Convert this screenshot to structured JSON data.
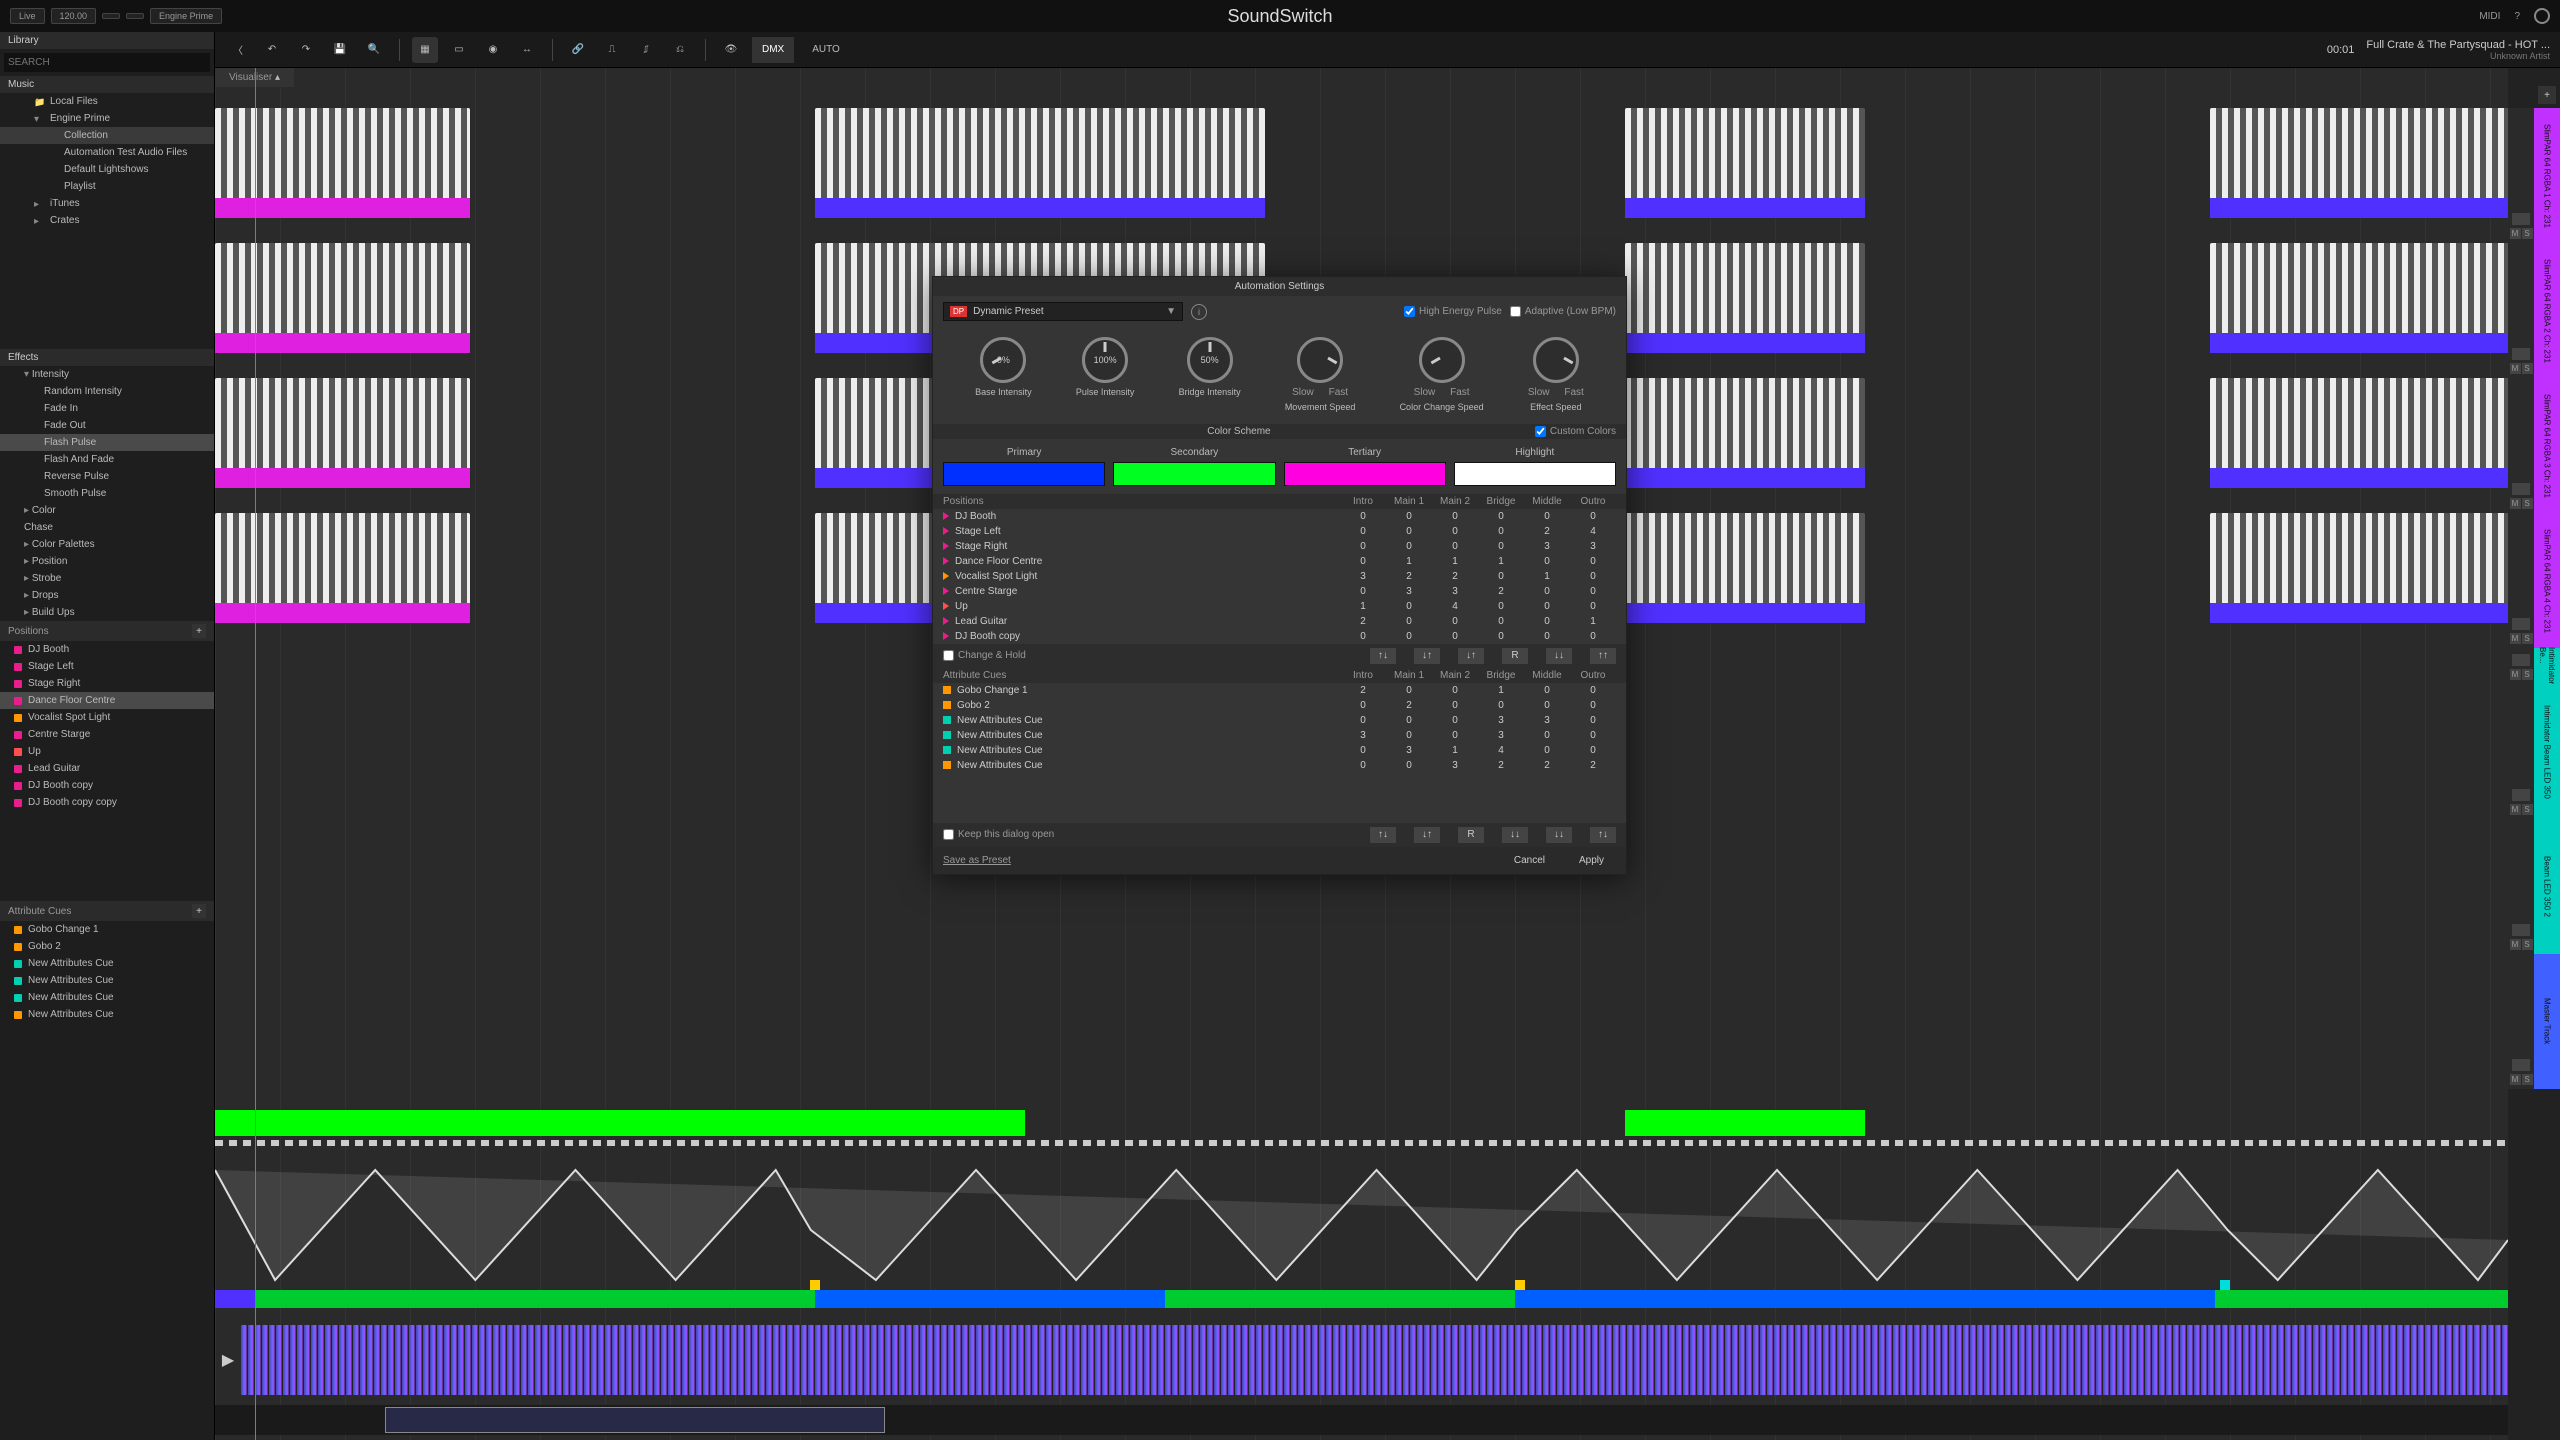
{
  "app": {
    "title": "SoundSwitch"
  },
  "topbar": {
    "live": "Live",
    "bpm": "120.00",
    "source": "Engine Prime",
    "midi": "MIDI",
    "help": "?"
  },
  "toolbar": {
    "dmx": "DMX",
    "auto": "AUTO",
    "time": "00:01",
    "track_title": "Full Crate & The Partysquad - HOT ...",
    "track_artist": "Unknown Artist",
    "visualiser": "Visualiser"
  },
  "library": {
    "header": "Library",
    "search_ph": "SEARCH",
    "music": "Music",
    "items": [
      {
        "label": "Local Files",
        "cls": "folder sub"
      },
      {
        "label": "Engine Prime",
        "cls": "expand2 sub"
      },
      {
        "label": "Collection",
        "cls": "sub2 sel"
      },
      {
        "label": "Automation Test Audio Files",
        "cls": "sub2"
      },
      {
        "label": "Default Lightshows",
        "cls": "sub2"
      },
      {
        "label": "Playlist",
        "cls": "sub2"
      },
      {
        "label": "iTunes",
        "cls": "expand sub"
      },
      {
        "label": "Crates",
        "cls": "expand sub"
      }
    ]
  },
  "effects": {
    "header": "Effects",
    "items": [
      {
        "label": "Intensity",
        "cls": "exp2"
      },
      {
        "label": "Random Intensity",
        "cls": "",
        "pad": "44px"
      },
      {
        "label": "Fade In",
        "cls": "",
        "pad": "44px"
      },
      {
        "label": "Fade Out",
        "cls": "",
        "pad": "44px"
      },
      {
        "label": "Flash Pulse",
        "cls": "sel",
        "pad": "44px"
      },
      {
        "label": "Flash And Fade",
        "cls": "",
        "pad": "44px"
      },
      {
        "label": "Reverse Pulse",
        "cls": "",
        "pad": "44px"
      },
      {
        "label": "Smooth Pulse",
        "cls": "",
        "pad": "44px"
      },
      {
        "label": "Color",
        "cls": "exp"
      },
      {
        "label": "Chase",
        "cls": ""
      },
      {
        "label": "Color Palettes",
        "cls": "exp"
      },
      {
        "label": "Position",
        "cls": "exp"
      },
      {
        "label": "Strobe",
        "cls": "exp"
      },
      {
        "label": "Drops",
        "cls": "exp"
      },
      {
        "label": "Build Ups",
        "cls": "exp"
      }
    ]
  },
  "positions": {
    "header": "Positions",
    "items": [
      {
        "label": "DJ Booth",
        "color": "#e91e8c"
      },
      {
        "label": "Stage Left",
        "color": "#e91e8c"
      },
      {
        "label": "Stage Right",
        "color": "#e91e8c"
      },
      {
        "label": "Dance Floor Centre",
        "color": "#e91e8c",
        "sel": true
      },
      {
        "label": "Vocalist Spot Light",
        "color": "#ff9800"
      },
      {
        "label": "Centre Starge",
        "color": "#e91e8c"
      },
      {
        "label": "Up",
        "color": "#ff5050"
      },
      {
        "label": "Lead Guitar",
        "color": "#e91e8c"
      },
      {
        "label": "DJ Booth copy",
        "color": "#e91e8c"
      },
      {
        "label": "DJ Booth copy copy",
        "color": "#e91e8c"
      }
    ]
  },
  "attrcues": {
    "header": "Attribute Cues",
    "items": [
      {
        "label": "Gobo Change 1",
        "color": "#ff9800"
      },
      {
        "label": "Gobo 2",
        "color": "#ff9800"
      },
      {
        "label": "New Attributes Cue",
        "color": "#00d0b0"
      },
      {
        "label": "New Attributes Cue",
        "color": "#00d0b0"
      },
      {
        "label": "New Attributes Cue",
        "color": "#00d0b0"
      },
      {
        "label": "New Attributes Cue",
        "color": "#ff9800"
      }
    ]
  },
  "tracks": [
    {
      "name": "SlimPAR 64 RGBA 1",
      "sub": "Ch: 231",
      "color": "#c030ff"
    },
    {
      "name": "SlimPAR 64 RGBA 2",
      "sub": "Ch: 231",
      "color": "#c030ff"
    },
    {
      "name": "SlimPAR 64 RGBA 3",
      "sub": "Ch: 231",
      "color": "#c030ff"
    },
    {
      "name": "SlimPAR 64 RGBA 4",
      "sub": "Ch: 231",
      "color": "#c030ff"
    },
    {
      "name": "Intimidator Be...",
      "sub": "",
      "color": "#00d0c0"
    },
    {
      "name": "Intimidator Beam LED 350",
      "sub": "",
      "color": "#00d0c0"
    },
    {
      "name": "Beam LED 350 2",
      "sub": "",
      "color": "#00d0c0"
    },
    {
      "name": "Master Track",
      "sub": "",
      "color": "#4060ff"
    }
  ],
  "dialog": {
    "title": "Automation Settings",
    "preset_prefix": "DP",
    "preset": "Dynamic Preset",
    "high_energy": "High Energy Pulse",
    "adaptive": "Adaptive (Low BPM)",
    "knobs": [
      {
        "val": "0%",
        "label": "Base\nIntensity",
        "sub": null,
        "cls": "left"
      },
      {
        "val": "100%",
        "label": "Pulse\nIntensity",
        "sub": null,
        "cls": ""
      },
      {
        "val": "50%",
        "label": "Bridge\nIntensity",
        "sub": null,
        "cls": ""
      },
      {
        "val": "",
        "label": "Movement\nSpeed",
        "sub": [
          "Slow",
          "Fast"
        ],
        "cls": "right"
      },
      {
        "val": "",
        "label": "Color Change\nSpeed",
        "sub": [
          "Slow",
          "Fast"
        ],
        "cls": "left"
      },
      {
        "val": "",
        "label": "Effect\nSpeed",
        "sub": [
          "Slow",
          "Fast"
        ],
        "cls": "right"
      }
    ],
    "color_scheme": "Color Scheme",
    "custom_colors": "Custom Colors",
    "swatches": [
      {
        "label": "Primary",
        "color": "#0030ff"
      },
      {
        "label": "Secondary",
        "color": "#00ff20"
      },
      {
        "label": "Tertiary",
        "color": "#ff00e0"
      },
      {
        "label": "Highlight",
        "color": "#ffffff"
      }
    ],
    "pos_header": "Positions",
    "cols": [
      "Intro",
      "Main 1",
      "Main 2",
      "Bridge",
      "Middle",
      "Outro"
    ],
    "pos_rows": [
      {
        "name": "DJ Booth",
        "color": "#e91e8c",
        "v": [
          0,
          0,
          0,
          0,
          0,
          0
        ]
      },
      {
        "name": "Stage Left",
        "color": "#e91e8c",
        "v": [
          0,
          0,
          0,
          0,
          2,
          4
        ]
      },
      {
        "name": "Stage Right",
        "color": "#e91e8c",
        "v": [
          0,
          0,
          0,
          0,
          3,
          3
        ]
      },
      {
        "name": "Dance Floor Centre",
        "color": "#e91e8c",
        "v": [
          0,
          1,
          1,
          1,
          0,
          0
        ]
      },
      {
        "name": "Vocalist Spot Light",
        "color": "#ff9800",
        "v": [
          3,
          2,
          2,
          0,
          1,
          0
        ]
      },
      {
        "name": "Centre Starge",
        "color": "#e91e8c",
        "v": [
          0,
          3,
          3,
          2,
          0,
          0
        ]
      },
      {
        "name": "Up",
        "color": "#ff5050",
        "v": [
          1,
          0,
          4,
          0,
          0,
          0
        ]
      },
      {
        "name": "Lead Guitar",
        "color": "#e91e8c",
        "v": [
          2,
          0,
          0,
          0,
          0,
          1
        ]
      },
      {
        "name": "DJ Booth copy",
        "color": "#e91e8c",
        "v": [
          0,
          0,
          0,
          0,
          0,
          0
        ]
      }
    ],
    "change_hold": "Change & Hold",
    "attr_header": "Attribute Cues",
    "attr_rows": [
      {
        "name": "Gobo Change 1",
        "color": "#ff9800",
        "v": [
          2,
          0,
          0,
          1,
          0,
          0
        ]
      },
      {
        "name": "Gobo 2",
        "color": "#ff9800",
        "v": [
          0,
          2,
          0,
          0,
          0,
          0
        ]
      },
      {
        "name": "New Attributes Cue",
        "color": "#00d0b0",
        "v": [
          0,
          0,
          0,
          3,
          3,
          0
        ]
      },
      {
        "name": "New Attributes Cue",
        "color": "#00d0b0",
        "v": [
          3,
          0,
          0,
          3,
          0,
          0
        ]
      },
      {
        "name": "New Attributes Cue",
        "color": "#00d0b0",
        "v": [
          0,
          3,
          1,
          4,
          0,
          0
        ]
      },
      {
        "name": "New Attributes Cue",
        "color": "#ff9800",
        "v": [
          0,
          0,
          3,
          2,
          2,
          2
        ]
      }
    ],
    "arrow_btns": [
      "↑↓",
      "↓↑",
      "↓↑",
      "R",
      "↓↓",
      "↑↑"
    ],
    "arrow_btns2": [
      "↑↓",
      "↓↑",
      "R",
      "↓↓",
      "↓↓",
      "↑↓"
    ],
    "keep_open": "Keep this dialog open",
    "save_preset": "Save as Preset",
    "cancel": "Cancel",
    "apply": "Apply"
  },
  "clips": {
    "magenta": "#e020e0",
    "blue": "#5030ff"
  }
}
